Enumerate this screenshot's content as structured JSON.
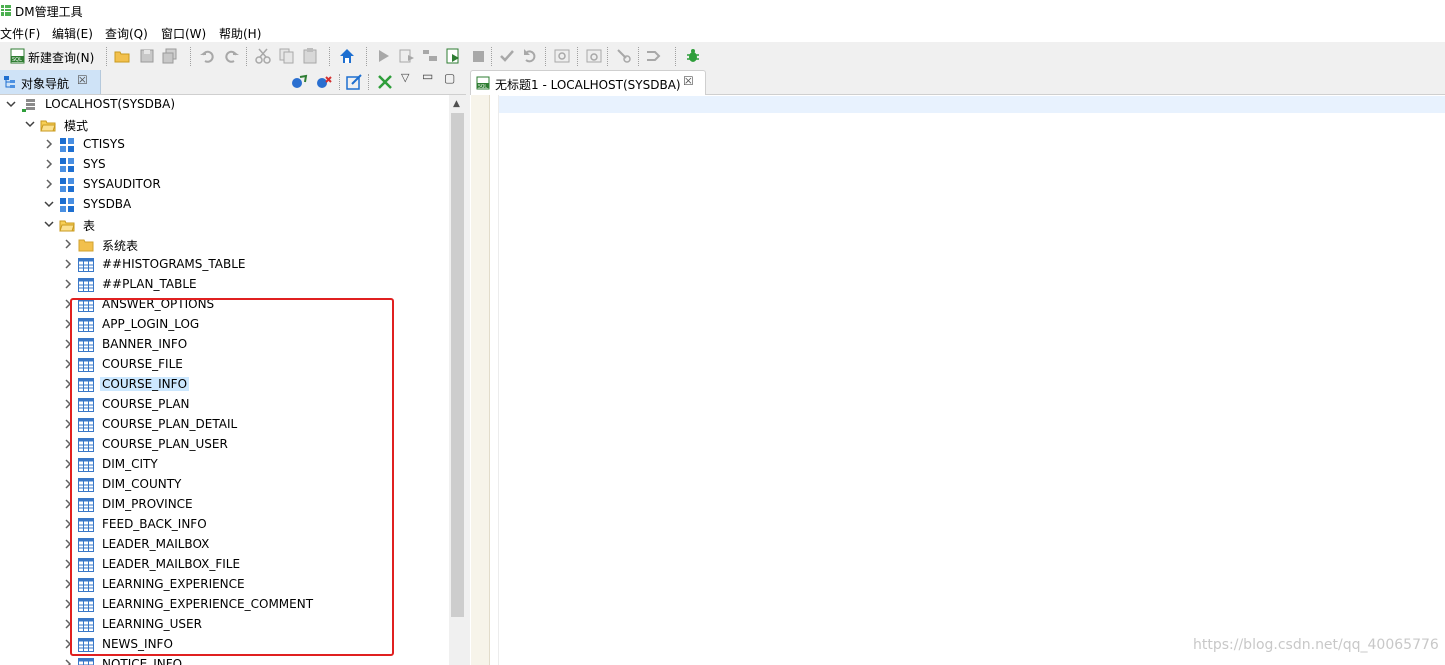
{
  "window": {
    "title": "DM管理工具"
  },
  "menu": [
    "文件(F)",
    "编辑(E)",
    "查询(Q)",
    "窗口(W)",
    "帮助(H)"
  ],
  "toolbar": {
    "new_query_label": "新建查询(N)"
  },
  "left_panel": {
    "tab_label": "对象导航",
    "tree": [
      {
        "label": "LOCALHOST(SYSDBA)",
        "level": 0,
        "expanded": true,
        "icon": "server-icon"
      },
      {
        "label": "模式",
        "level": 1,
        "expanded": true,
        "icon": "folder-open-icon"
      },
      {
        "label": "CTISYS",
        "level": 2,
        "expanded": false,
        "icon": "schema-icon"
      },
      {
        "label": "SYS",
        "level": 2,
        "expanded": false,
        "icon": "schema-icon"
      },
      {
        "label": "SYSAUDITOR",
        "level": 2,
        "expanded": false,
        "icon": "schema-icon"
      },
      {
        "label": "SYSDBA",
        "level": 2,
        "expanded": true,
        "icon": "schema-icon"
      },
      {
        "label": "表",
        "level": 3,
        "expanded": true,
        "icon": "folder-open-icon"
      },
      {
        "label": "系统表",
        "level": 4,
        "expanded": false,
        "icon": "folder-icon"
      },
      {
        "label": "##HISTOGRAMS_TABLE",
        "level": 4,
        "expanded": false,
        "icon": "table-icon"
      },
      {
        "label": "##PLAN_TABLE",
        "level": 4,
        "expanded": false,
        "icon": "table-icon"
      },
      {
        "label": "ANSWER_OPTIONS",
        "level": 4,
        "expanded": false,
        "icon": "table-icon"
      },
      {
        "label": "APP_LOGIN_LOG",
        "level": 4,
        "expanded": false,
        "icon": "table-icon"
      },
      {
        "label": "BANNER_INFO",
        "level": 4,
        "expanded": false,
        "icon": "table-icon"
      },
      {
        "label": "COURSE_FILE",
        "level": 4,
        "expanded": false,
        "icon": "table-icon"
      },
      {
        "label": "COURSE_INFO",
        "level": 4,
        "expanded": false,
        "icon": "table-icon",
        "selected": true
      },
      {
        "label": "COURSE_PLAN",
        "level": 4,
        "expanded": false,
        "icon": "table-icon"
      },
      {
        "label": "COURSE_PLAN_DETAIL",
        "level": 4,
        "expanded": false,
        "icon": "table-icon"
      },
      {
        "label": "COURSE_PLAN_USER",
        "level": 4,
        "expanded": false,
        "icon": "table-icon"
      },
      {
        "label": "DIM_CITY",
        "level": 4,
        "expanded": false,
        "icon": "table-icon"
      },
      {
        "label": "DIM_COUNTY",
        "level": 4,
        "expanded": false,
        "icon": "table-icon"
      },
      {
        "label": "DIM_PROVINCE",
        "level": 4,
        "expanded": false,
        "icon": "table-icon"
      },
      {
        "label": "FEED_BACK_INFO",
        "level": 4,
        "expanded": false,
        "icon": "table-icon"
      },
      {
        "label": "LEADER_MAILBOX",
        "level": 4,
        "expanded": false,
        "icon": "table-icon"
      },
      {
        "label": "LEADER_MAILBOX_FILE",
        "level": 4,
        "expanded": false,
        "icon": "table-icon"
      },
      {
        "label": "LEARNING_EXPERIENCE",
        "level": 4,
        "expanded": false,
        "icon": "table-icon"
      },
      {
        "label": "LEARNING_EXPERIENCE_COMMENT",
        "level": 4,
        "expanded": false,
        "icon": "table-icon"
      },
      {
        "label": "LEARNING_USER",
        "level": 4,
        "expanded": false,
        "icon": "table-icon"
      },
      {
        "label": "NEWS_INFO",
        "level": 4,
        "expanded": false,
        "icon": "table-icon"
      },
      {
        "label": "NOTICE_INFO",
        "level": 4,
        "expanded": false,
        "icon": "table-icon"
      }
    ]
  },
  "editor": {
    "tab_label": "无标题1 - LOCALHOST(SYSDBA)"
  },
  "watermark": "https://blog.csdn.net/qq_40065776",
  "colors": {
    "highlight_box": "#e02020",
    "selection": "#cce8ff",
    "tab_active": "#cfe3f7"
  }
}
